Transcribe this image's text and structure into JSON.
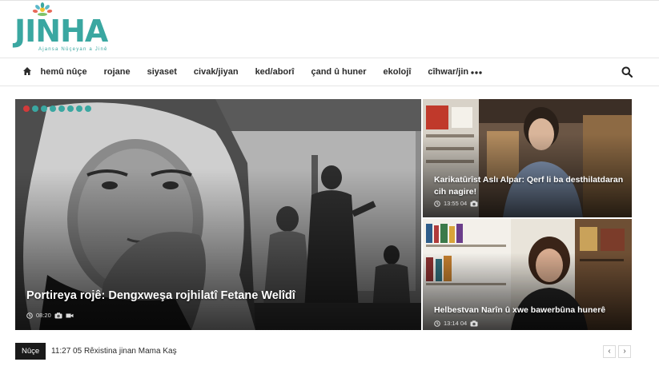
{
  "brand": {
    "name_jin": "JIN",
    "name_ha": "HA",
    "tagline": "Ajansa Nûçeyan a Jinê",
    "accent": "#3aa7a1"
  },
  "nav": {
    "home_icon": "home-icon",
    "items": [
      {
        "label": "hemû nûçe"
      },
      {
        "label": "rojane"
      },
      {
        "label": "siyaset"
      },
      {
        "label": "civak/jiyan"
      },
      {
        "label": "ked/aborî"
      },
      {
        "label": "çand û huner"
      },
      {
        "label": "ekolojî"
      },
      {
        "label": "cîhwar/jin"
      }
    ],
    "more_icon": "ellipsis-icon",
    "search_icon": "search-icon"
  },
  "featured": {
    "main": {
      "title": "Portireya rojê: Dengxweşa rojhilatî Fetane Welîdî",
      "time": "08:20",
      "icons": [
        "clock-icon",
        "camera-icon",
        "video-icon"
      ]
    },
    "side1": {
      "title": "Karikatûrîst Aslı Alpar: Qerf li ba desthilatdaran cih nagire!",
      "time": "13:55 04",
      "icons": [
        "clock-icon",
        "camera-icon"
      ]
    },
    "side2": {
      "title": "Helbestvan Narîn û xwe bawerbûna hunerê",
      "time": "13:14 04",
      "icons": [
        "clock-icon",
        "camera-icon"
      ]
    },
    "slider_count": 8,
    "slider_active": 1,
    "dot_active_color": "#d23a3a"
  },
  "ticker": {
    "label": "Nûçe",
    "text": "11:27 05 Rêxistina jinan Mama Kaş",
    "prev": "‹",
    "next": "›"
  }
}
